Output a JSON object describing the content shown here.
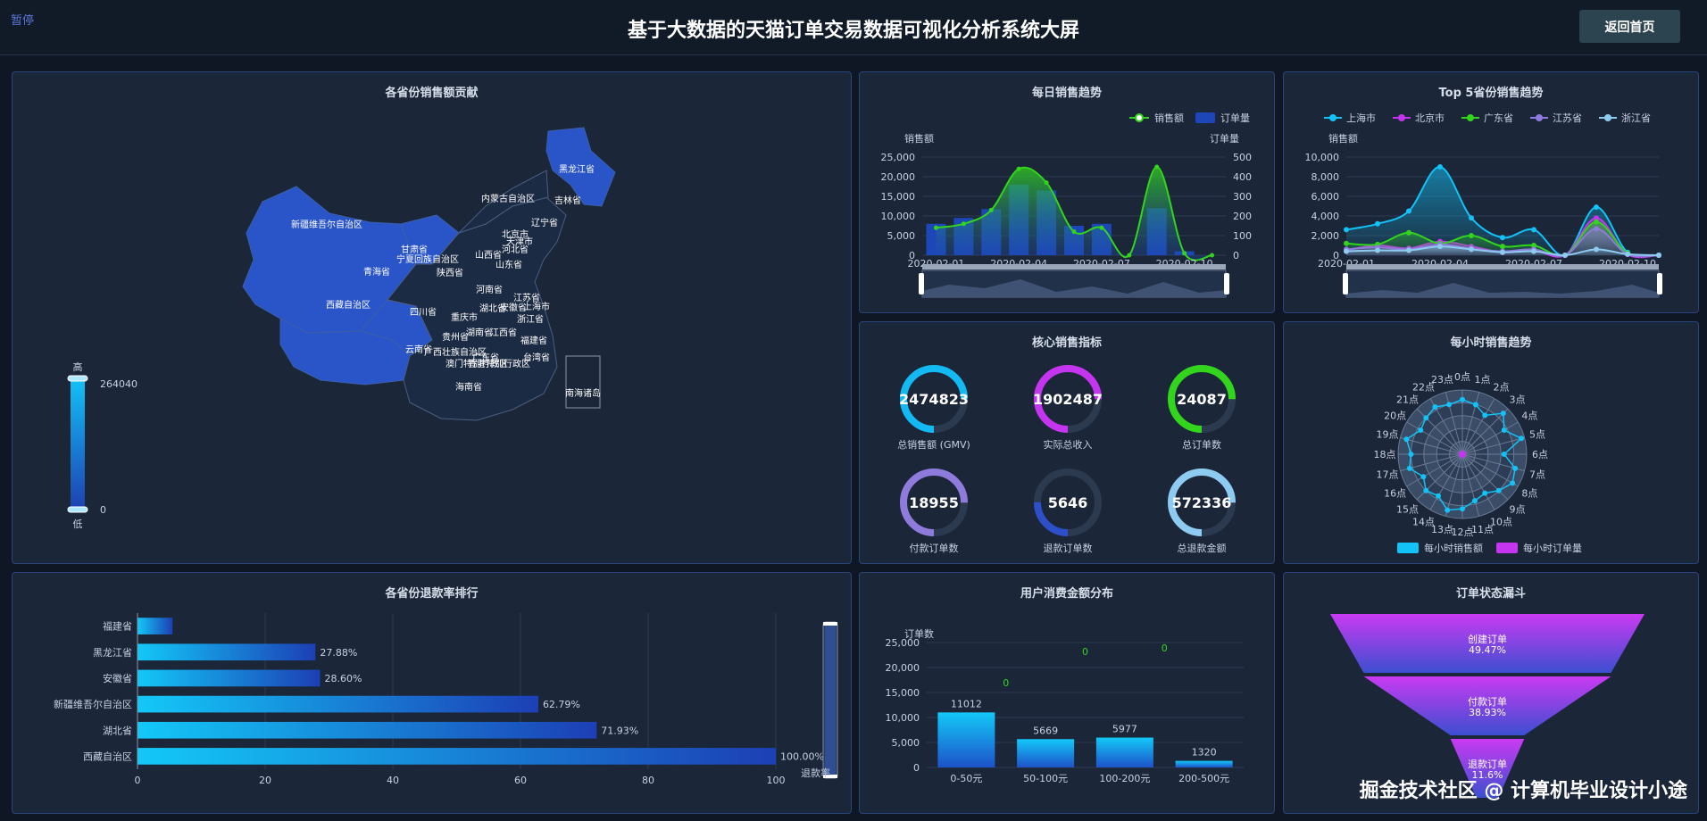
{
  "header": {
    "pause_label": "暂停",
    "title": "基于大数据的天猫订单交易数据可视化分析系统大屏",
    "home_button": "返回首页"
  },
  "colors": {
    "accent_blue": "#1a8cf3",
    "cyan": "#13c2f7",
    "purple": "#c535f0",
    "green": "#32d41c",
    "lavender": "#8f7bdc",
    "light_blue": "#8ecbf0"
  },
  "map": {
    "title": "各省份销售额贡献",
    "legend_high": "高",
    "legend_low": "低",
    "legend_max": "264040",
    "legend_min": "0",
    "labels": [
      "黑龙江省",
      "吉林省",
      "内蒙古自治区",
      "辽宁省",
      "新疆维吾尔自治区",
      "甘肃省",
      "宁夏回族自治区",
      "北京市",
      "天津市",
      "河北省",
      "山西省",
      "山东省",
      "青海省",
      "陕西省",
      "河南省",
      "江苏省",
      "安徽省",
      "上海市",
      "西藏自治区",
      "四川省",
      "湖北省",
      "重庆市",
      "浙江省",
      "贵州省",
      "湖南省",
      "江西省",
      "福建省",
      "云南省",
      "广西壮族自治区",
      "广东省",
      "台湾省",
      "香港特别行政区",
      "澳门特别行政区",
      "海南省",
      "南海诸岛"
    ]
  },
  "daily": {
    "title": "每日销售趋势",
    "legend_sales": "销售额",
    "legend_orders": "订单量",
    "ylabel_left": "销售额",
    "ylabel_right": "订单量",
    "left_ticks": [
      "0",
      "5,000",
      "10,000",
      "15,000",
      "20,000",
      "25,000"
    ],
    "right_ticks": [
      "0",
      "100",
      "200",
      "300",
      "400",
      "500"
    ],
    "x_ticks": [
      "2020-02-01",
      "2020-02-04",
      "2020-02-07",
      "2020-02-10"
    ]
  },
  "top5": {
    "title": "Top 5省份销售趋势",
    "legend": [
      "上海市",
      "北京市",
      "广东省",
      "江苏省",
      "浙江省"
    ],
    "ylabel": "销售额",
    "y_ticks": [
      "0",
      "2,000",
      "4,000",
      "6,000",
      "8,000",
      "10,000"
    ],
    "x_ticks": [
      "2020-02-01",
      "2020-02-04",
      "2020-02-07",
      "2020-02-10"
    ]
  },
  "kpi": {
    "title": "核心销售指标",
    "items": [
      {
        "value": "2474823",
        "label": "总销售额 (GMV)",
        "color": "#13b9f2",
        "ratio": 0.75
      },
      {
        "value": "1902487",
        "label": "实际总收入",
        "color": "#c535f0",
        "ratio": 0.75
      },
      {
        "value": "24087",
        "label": "总订单数",
        "color": "#32d41c",
        "ratio": 0.75
      },
      {
        "value": "18955",
        "label": "付款订单数",
        "color": "#8f7bdc",
        "ratio": 0.75
      },
      {
        "value": "5646",
        "label": "退款订单数",
        "color": "#2d4fc9",
        "ratio": 0.25
      },
      {
        "value": "572336",
        "label": "总退款金额",
        "color": "#8ecbf0",
        "ratio": 0.75
      }
    ]
  },
  "hourly": {
    "title": "每小时销售趋势",
    "hours": [
      "0点",
      "1点",
      "2点",
      "3点",
      "4点",
      "5点",
      "6点",
      "7点",
      "8点",
      "9点",
      "10点",
      "11点",
      "12点",
      "13点",
      "14点",
      "15点",
      "16点",
      "17点",
      "18点",
      "19点",
      "20点",
      "21点",
      "22点",
      "23点"
    ],
    "legend_sales": "每小时销售额",
    "legend_orders": "每小时订单量"
  },
  "refund": {
    "title": "各省份退款率排行",
    "x_ticks": [
      "0",
      "20",
      "40",
      "60",
      "80",
      "100"
    ],
    "zoom_label": "退款率",
    "categories": [
      "福建省",
      "黑龙江省",
      "安徽省",
      "新疆维吾尔自治区",
      "湖北省",
      "西藏自治区"
    ],
    "labels": [
      "27.88%",
      "28.60%",
      "62.79%",
      "71.93%",
      "100.00%"
    ]
  },
  "spend": {
    "title": "用户消费金额分布",
    "ylabel": "订单数",
    "y_ticks": [
      "0",
      "5,000",
      "10,000",
      "15,000",
      "20,000",
      "25,000"
    ]
  },
  "funnel": {
    "title": "订单状态漏斗",
    "stages": [
      {
        "name": "创建订单",
        "pct": "49.47%"
      },
      {
        "name": "付款订单",
        "pct": "38.93%"
      },
      {
        "name": "退款订单",
        "pct": "11.6%"
      }
    ]
  },
  "watermark": "掘金技术社区 @ 计算机毕业设计小途",
  "chart_data": [
    {
      "type": "line",
      "title": "每日销售趋势",
      "x": [
        "2020-02-01",
        "2020-02-02",
        "2020-02-03",
        "2020-02-04",
        "2020-02-05",
        "2020-02-06",
        "2020-02-07",
        "2020-02-08",
        "2020-02-09",
        "2020-02-10",
        "2020-02-11"
      ],
      "series": [
        {
          "name": "销售额",
          "axis": "left",
          "values": [
            7000,
            8000,
            11500,
            22000,
            18500,
            6000,
            7000,
            0,
            22500,
            500,
            0
          ]
        },
        {
          "name": "订单量",
          "axis": "right",
          "type": "bar",
          "values": [
            160,
            190,
            235,
            360,
            330,
            150,
            160,
            0,
            240,
            20,
            0
          ]
        }
      ],
      "ylim_left": [
        0,
        25000
      ],
      "ylim_right": [
        0,
        500
      ]
    },
    {
      "type": "line",
      "title": "Top 5省份销售趋势",
      "x": [
        "2020-02-01",
        "2020-02-02",
        "2020-02-03",
        "2020-02-04",
        "2020-02-05",
        "2020-02-06",
        "2020-02-07",
        "2020-02-08",
        "2020-02-09",
        "2020-02-10",
        "2020-02-11"
      ],
      "series": [
        {
          "name": "上海市",
          "values": [
            2600,
            3200,
            4500,
            9000,
            3800,
            1800,
            2600,
            0,
            4900,
            300,
            0
          ]
        },
        {
          "name": "北京市",
          "values": [
            500,
            1000,
            700,
            1400,
            900,
            300,
            500,
            0,
            3800,
            100,
            0
          ]
        },
        {
          "name": "广东省",
          "values": [
            1200,
            1100,
            2300,
            1200,
            2000,
            900,
            1000,
            0,
            3400,
            200,
            0
          ]
        },
        {
          "name": "江苏省",
          "values": [
            600,
            800,
            600,
            1100,
            700,
            400,
            600,
            0,
            2700,
            100,
            0
          ]
        },
        {
          "name": "浙江省",
          "values": [
            400,
            500,
            500,
            900,
            600,
            300,
            400,
            0,
            600,
            100,
            0
          ]
        }
      ],
      "ylim": [
        0,
        10000
      ]
    },
    {
      "type": "radar",
      "title": "每小时销售趋势",
      "categories": [
        "0点",
        "1点",
        "2点",
        "3点",
        "4点",
        "5点",
        "6点",
        "7点",
        "8点",
        "9点",
        "10点",
        "11点",
        "12点",
        "13点",
        "14点",
        "15点",
        "16点",
        "17点",
        "18点",
        "19点",
        "20点",
        "21点",
        "22点",
        "23点"
      ],
      "series": [
        {
          "name": "每小时销售额",
          "values": [
            0.85,
            0.8,
            0.7,
            0.9,
            0.75,
            0.95,
            0.65,
            0.85,
            0.9,
            0.8,
            0.7,
            0.75,
            0.85,
            0.9,
            0.75,
            0.8,
            0.7,
            0.85,
            0.8,
            0.9,
            0.75,
            0.8,
            0.85,
            0.8
          ]
        },
        {
          "name": "每小时订单量",
          "values": [
            0.02,
            0.02,
            0.02,
            0.02,
            0.02,
            0.02,
            0.02,
            0.02,
            0.02,
            0.02,
            0.02,
            0.02,
            0.02,
            0.02,
            0.02,
            0.02,
            0.02,
            0.02,
            0.02,
            0.02,
            0.02,
            0.02,
            0.02,
            0.02
          ]
        }
      ]
    },
    {
      "type": "bar",
      "title": "各省份退款率排行",
      "categories": [
        "福建省",
        "黑龙江省",
        "安徽省",
        "新疆维吾尔自治区",
        "湖北省",
        "西藏自治区"
      ],
      "values": [
        5.5,
        27.88,
        28.6,
        62.79,
        71.93,
        100.0
      ],
      "xlim": [
        0,
        100
      ]
    },
    {
      "type": "bar",
      "title": "用户消费金额分布",
      "categories": [
        "0-50元",
        "50-100元",
        "100-200元",
        "200-500元"
      ],
      "values": [
        11012,
        5669,
        5977,
        1320
      ],
      "ylim": [
        0,
        25000
      ]
    },
    {
      "type": "funnel",
      "title": "订单状态漏斗",
      "categories": [
        "创建订单",
        "付款订单",
        "退款订单"
      ],
      "values": [
        49.47,
        38.93,
        11.6
      ]
    }
  ]
}
